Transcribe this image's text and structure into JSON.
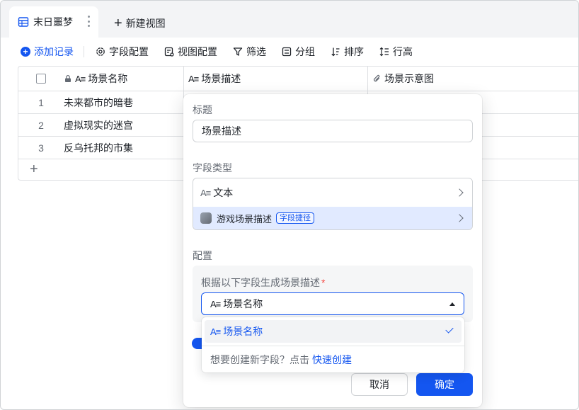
{
  "tabs": {
    "active_label": "末日噩梦",
    "new_view_label": "新建视图"
  },
  "toolbar": {
    "add_record": "添加记录",
    "field_config": "字段配置",
    "view_config": "视图配置",
    "filter": "筛选",
    "group": "分组",
    "sort": "排序",
    "row_height": "行高"
  },
  "grid": {
    "columns": [
      "场景名称",
      "场景描述",
      "场景示意图"
    ],
    "rows": [
      {
        "num": "1",
        "name": "未来都市的暗巷"
      },
      {
        "num": "2",
        "name": "虚拟现实的迷宫"
      },
      {
        "num": "3",
        "name": "反乌托邦的市集"
      }
    ],
    "add_row": "+"
  },
  "popover": {
    "title_label": "标题",
    "title_value": "场景描述",
    "field_type_label": "字段类型",
    "type_text": "文本",
    "type_shortcut": "游戏场景描述",
    "shortcut_badge": "字段捷径",
    "config_label": "配置",
    "source_label": "根据以下字段生成场景描述",
    "required_mark": "*",
    "source_value": "场景名称",
    "cancel": "取消",
    "confirm": "确定"
  },
  "dropdown": {
    "option": "场景名称",
    "hint": "想要创建新字段？点击",
    "quick_create": "快速创建"
  },
  "colors": {
    "accent": "#1456f0",
    "required": "#f54a45",
    "selected_bg": "#e1eaff"
  }
}
